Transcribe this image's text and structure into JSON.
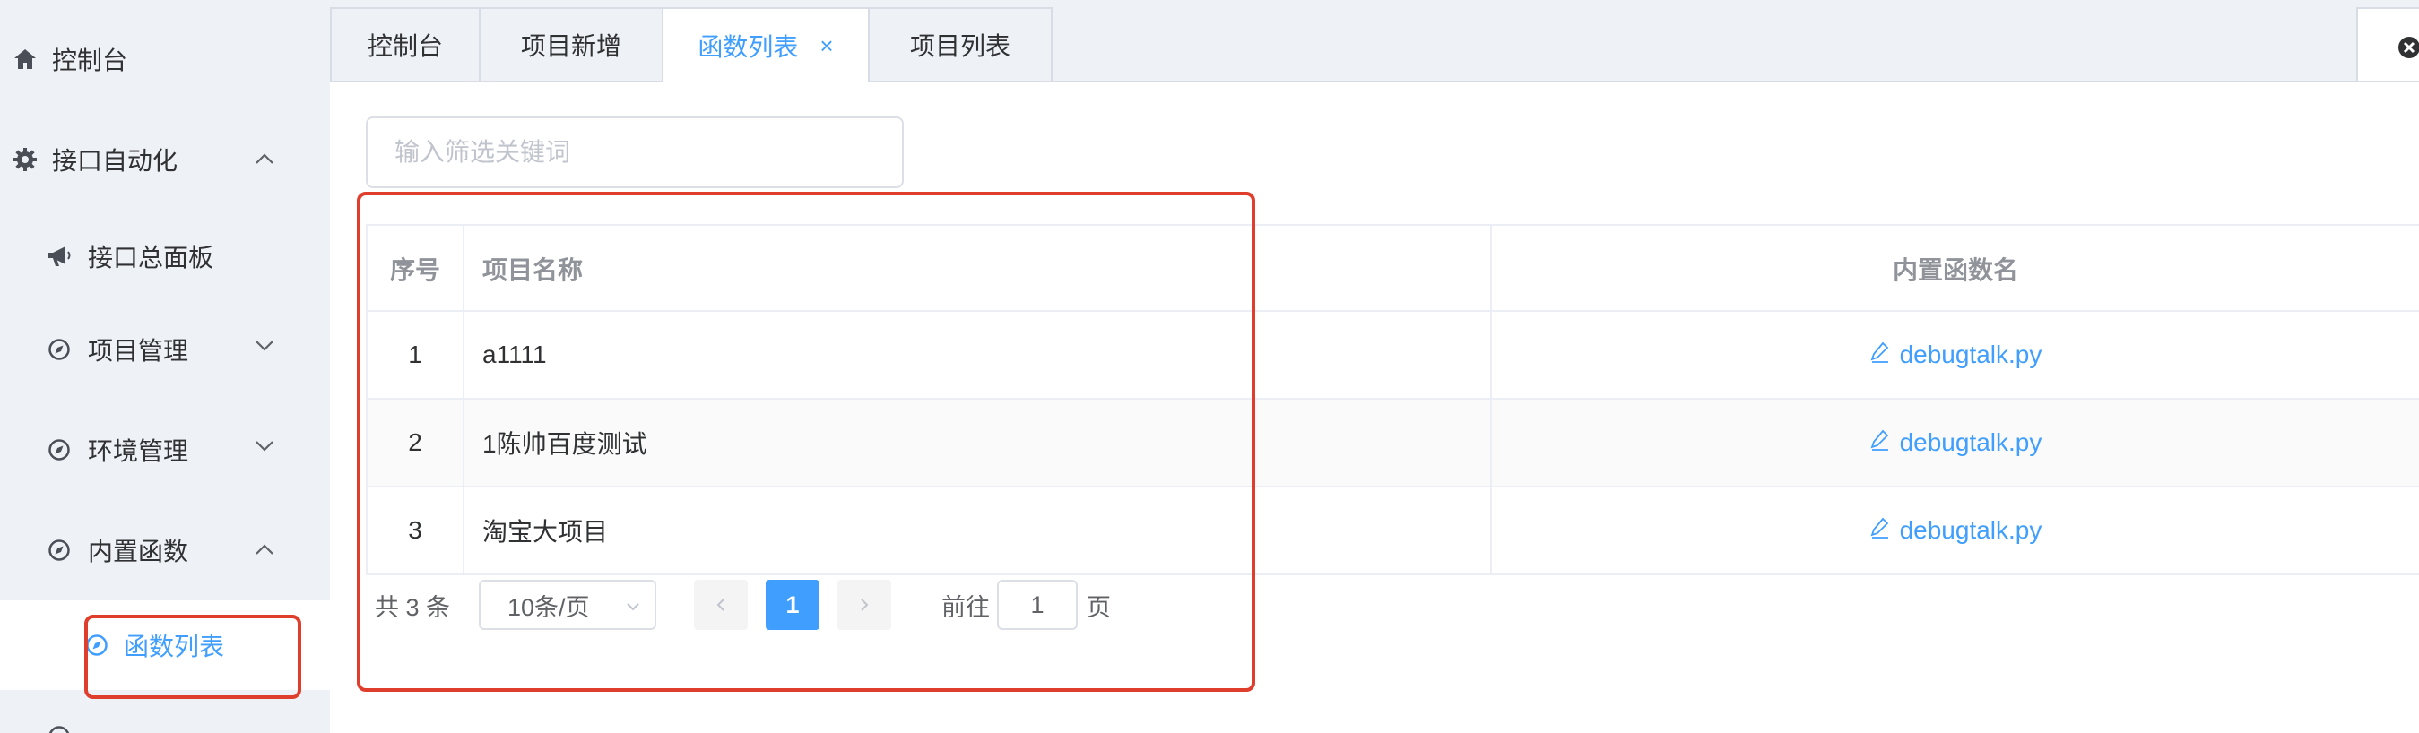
{
  "sidebar": {
    "items": [
      {
        "label": "控制台",
        "icon": "home-icon"
      },
      {
        "label": "接口自动化",
        "icon": "gear-icon",
        "expanded": true
      },
      {
        "label": "接口总面板",
        "icon": "megaphone-icon"
      },
      {
        "label": "项目管理",
        "icon": "compass-icon",
        "expanded": false
      },
      {
        "label": "环境管理",
        "icon": "compass-icon",
        "expanded": false
      },
      {
        "label": "内置函数",
        "icon": "compass-icon",
        "expanded": true
      },
      {
        "label": "函数列表",
        "icon": "compass-icon",
        "active": true
      }
    ]
  },
  "tabs": [
    {
      "label": "控制台"
    },
    {
      "label": "项目新增"
    },
    {
      "label": "函数列表",
      "active": true,
      "close": "×"
    },
    {
      "label": "项目列表"
    }
  ],
  "search": {
    "placeholder": "输入筛选关键词"
  },
  "table": {
    "columns": [
      "序号",
      "项目名称",
      "内置函数名"
    ],
    "rows": [
      {
        "index": "1",
        "name": "a1111",
        "func": "debugtalk.py"
      },
      {
        "index": "2",
        "name": "1陈帅百度测试",
        "func": "debugtalk.py"
      },
      {
        "index": "3",
        "name": "淘宝大项目",
        "func": "debugtalk.py"
      }
    ]
  },
  "pagination": {
    "total_text": "共 3 条",
    "page_size": "10条/页",
    "current_page": "1",
    "goto_label": "前往",
    "goto_value": "1",
    "page_suffix": "页"
  },
  "colors": {
    "accent": "#409eff",
    "highlight": "#e03e2d",
    "sidebar_bg": "#eef1f6"
  }
}
